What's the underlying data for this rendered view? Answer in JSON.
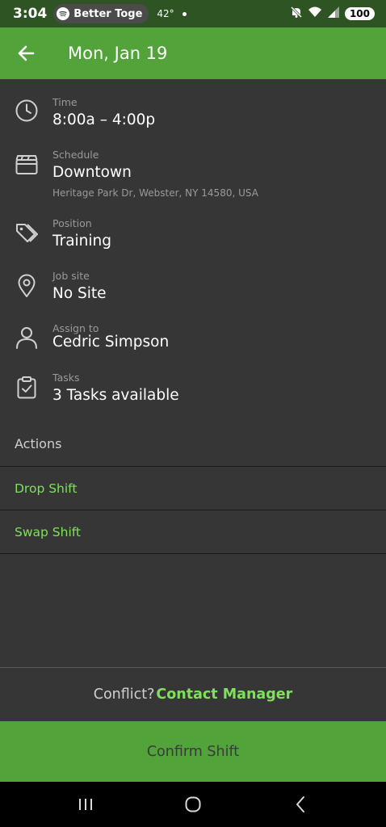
{
  "status_bar": {
    "time": "3:04",
    "media_app": "Better Toge",
    "temperature": "42°",
    "battery": "100",
    "icons": [
      "spotify-icon",
      "mute-icon",
      "wifi-icon",
      "signal-icon",
      "battery-icon"
    ]
  },
  "header": {
    "title": "Mon, Jan 19",
    "back_icon": "arrow-left-icon"
  },
  "details": {
    "time": {
      "label": "Time",
      "value": "8:00a – 4:00p",
      "icon": "clock-icon"
    },
    "schedule": {
      "label": "Schedule",
      "value": "Downtown",
      "address": "Heritage Park Dr, Webster, NY 14580, USA",
      "icon": "schedule-icon"
    },
    "position": {
      "label": "Position",
      "value": "Training",
      "icon": "tags-icon"
    },
    "job_site": {
      "label": "Job site",
      "value": "No Site",
      "icon": "location-pin-icon"
    },
    "assign_to": {
      "label": "Assign to",
      "value": "Cedric Simpson",
      "icon": "person-icon"
    },
    "tasks": {
      "label": "Tasks",
      "value": "3 Tasks available",
      "icon": "clipboard-check-icon"
    }
  },
  "actions": {
    "title": "Actions",
    "items": [
      "Drop Shift",
      "Swap Shift"
    ]
  },
  "conflict": {
    "question": "Conflict?",
    "link": "Contact Manager"
  },
  "confirm_label": "Confirm Shift",
  "colors": {
    "accent": "#52a33a",
    "link_green": "#7ee05c",
    "background": "#363636",
    "status_bar": "#2f5424"
  },
  "nav_bar": [
    "recent-apps-icon",
    "home-icon",
    "back-icon"
  ]
}
